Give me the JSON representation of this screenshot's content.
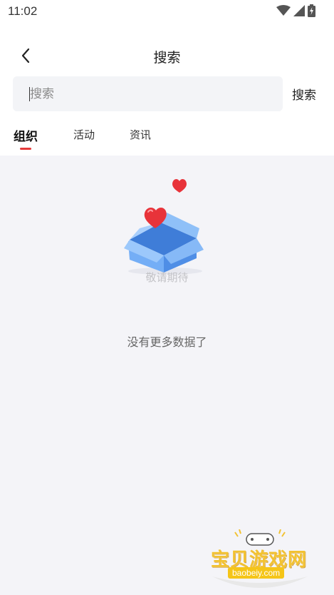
{
  "status_bar": {
    "time": "11:02",
    "icons": [
      "wifi-icon",
      "cellular-signal-icon",
      "battery-charging-icon"
    ]
  },
  "header": {
    "back_icon": "chevron-left-icon",
    "title": "搜索"
  },
  "search": {
    "placeholder": "搜索",
    "value": "",
    "button_label": "搜索"
  },
  "tabs": [
    {
      "label": "组织",
      "active": true
    },
    {
      "label": "活动",
      "active": false
    },
    {
      "label": "资讯",
      "active": false
    }
  ],
  "empty_state": {
    "illustration": "open-box-with-hearts-illustration",
    "caption": "敬请期待",
    "no_more_text": "没有更多数据了"
  },
  "watermark": {
    "title": "宝贝游戏网",
    "url": "baobeiy.com"
  },
  "colors": {
    "accent": "#e63a3a",
    "background": "#f4f4f8",
    "search_bg": "#f3f4f7",
    "box_blue": "#5a9bef",
    "heart_red": "#e8333a"
  }
}
